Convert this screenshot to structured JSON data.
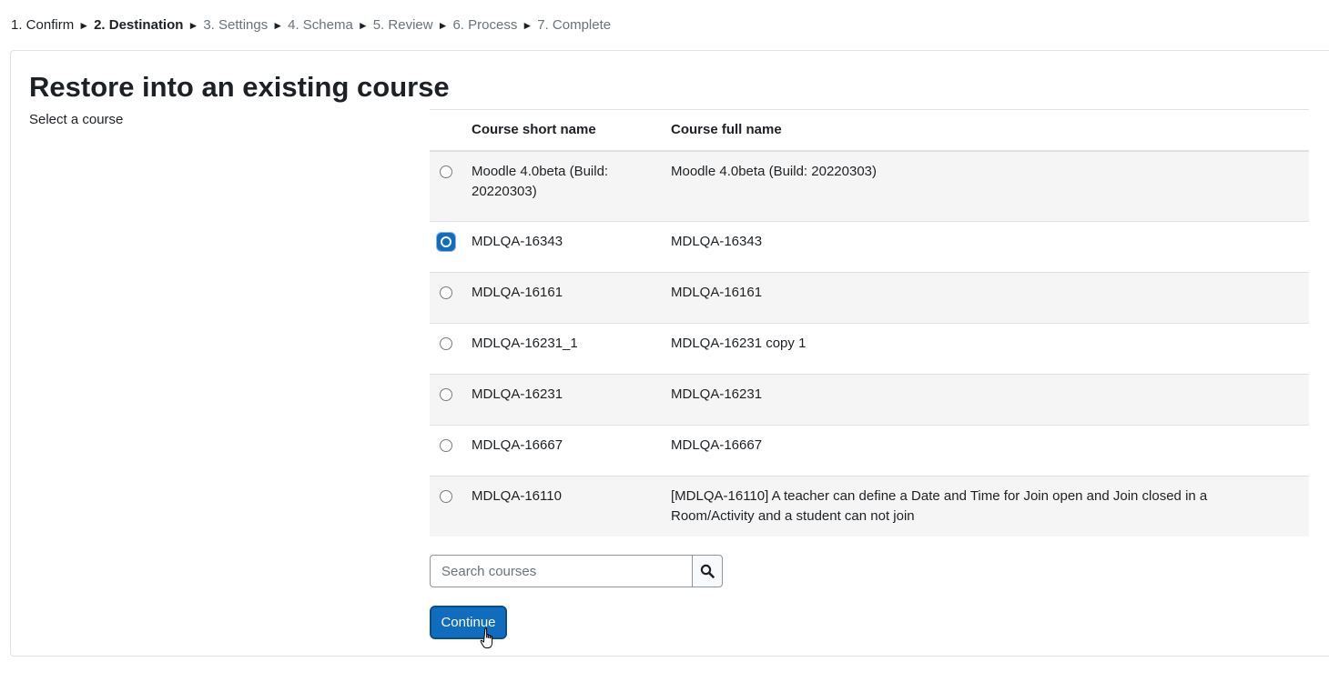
{
  "stepper": {
    "separator": "►",
    "steps": [
      {
        "label": "1. Confirm",
        "state": "done"
      },
      {
        "label": "2. Destination",
        "state": "current"
      },
      {
        "label": "3. Settings",
        "state": "upcoming"
      },
      {
        "label": "4. Schema",
        "state": "upcoming"
      },
      {
        "label": "5. Review",
        "state": "upcoming"
      },
      {
        "label": "6. Process",
        "state": "upcoming"
      },
      {
        "label": "7. Complete",
        "state": "upcoming"
      }
    ]
  },
  "main": {
    "title": "Restore into an existing course",
    "select_label": "Select a course"
  },
  "table": {
    "headers": {
      "short_name": "Course short name",
      "full_name": "Course full name"
    },
    "rows": [
      {
        "short_name": "Moodle 4.0beta (Build: 20220303)",
        "full_name": "Moodle 4.0beta (Build: 20220303)",
        "selected": false
      },
      {
        "short_name": "MDLQA-16343",
        "full_name": "MDLQA-16343",
        "selected": true
      },
      {
        "short_name": "MDLQA-16161",
        "full_name": "MDLQA-16161",
        "selected": false
      },
      {
        "short_name": "MDLQA-16231_1",
        "full_name": "MDLQA-16231 copy 1",
        "selected": false
      },
      {
        "short_name": "MDLQA-16231",
        "full_name": "MDLQA-16231",
        "selected": false
      },
      {
        "short_name": "MDLQA-16667",
        "full_name": "MDLQA-16667",
        "selected": false
      },
      {
        "short_name": "MDLQA-16110",
        "full_name": "[MDLQA-16110] A teacher can define a Date and Time for Join open and Join closed in a Room/Activity and a student can not join",
        "selected": false
      }
    ]
  },
  "search": {
    "placeholder": "Search courses",
    "value": "",
    "icon": "search-icon"
  },
  "actions": {
    "continue_label": "Continue"
  },
  "colors": {
    "primary": "#0f6cbf",
    "text": "#1d2125",
    "muted": "#6a737b",
    "row_stripe": "#f5f5f5"
  }
}
